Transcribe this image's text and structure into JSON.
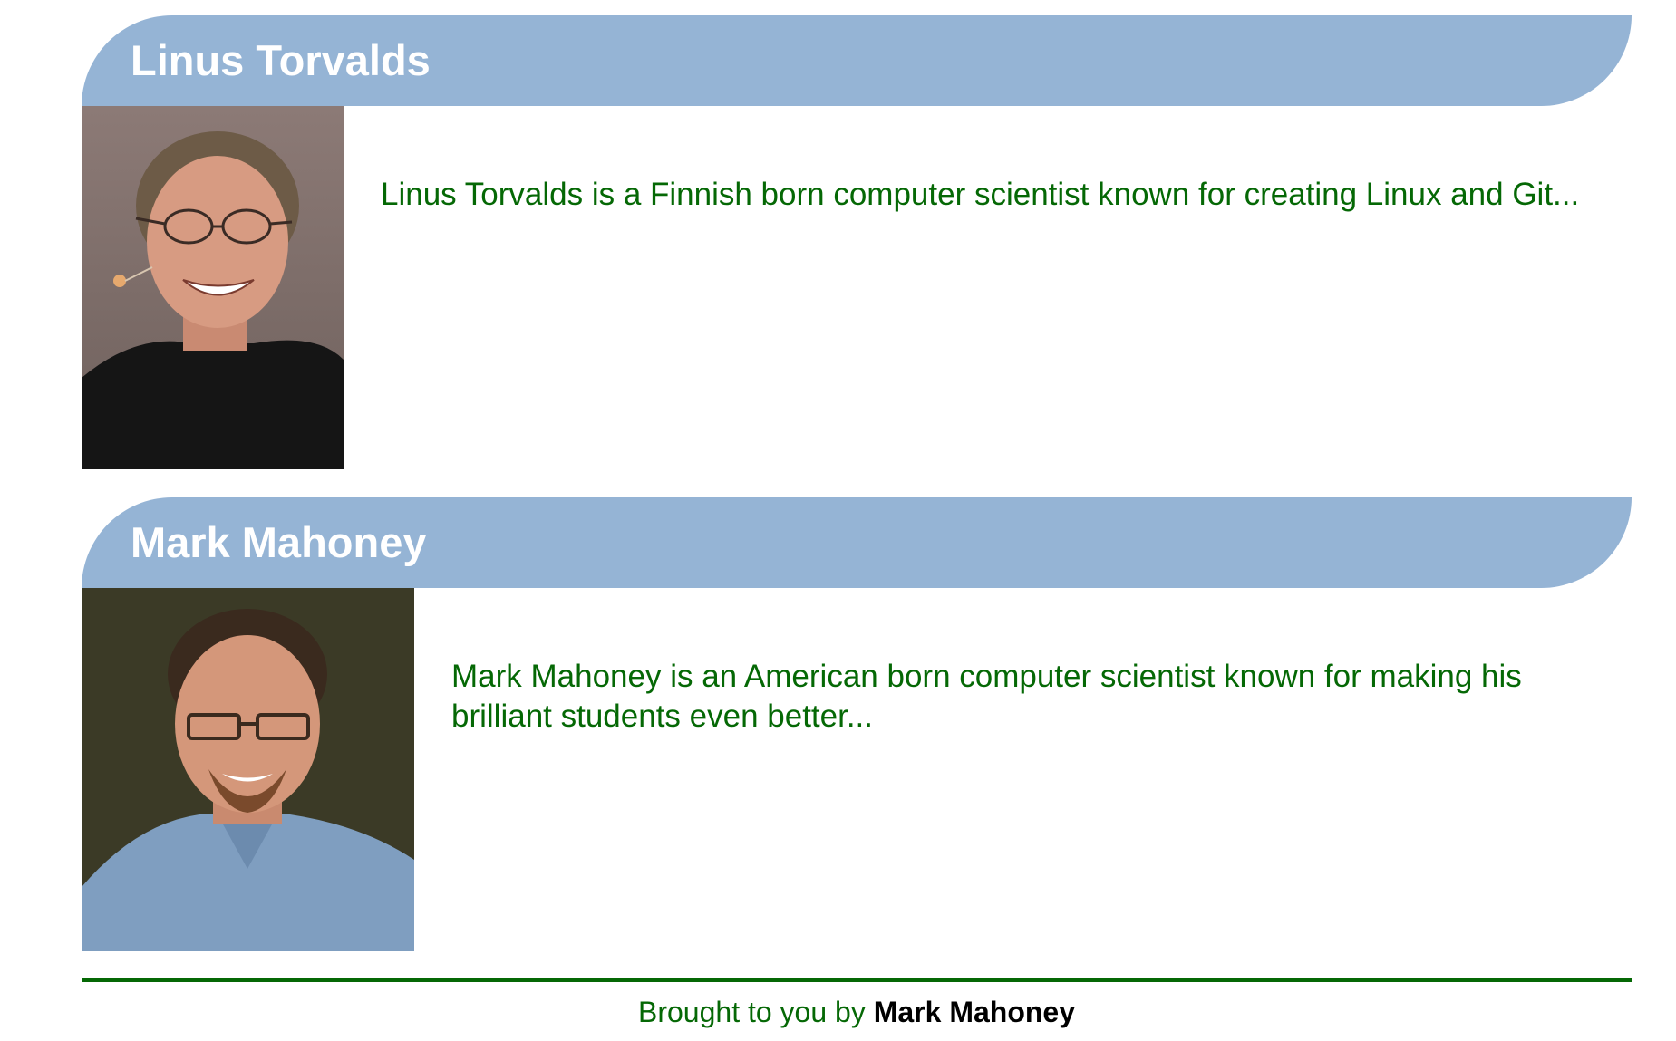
{
  "people": [
    {
      "name": "Linus Torvalds",
      "bio": "Linus Torvalds is a Finnish born computer scientist known for creating Linux and Git..."
    },
    {
      "name": "Mark Mahoney",
      "bio": "Mark Mahoney is an American born computer scientist known for making his brilliant students even better..."
    }
  ],
  "footer": {
    "prefix": "Brought to you by",
    "author": "Mark Mahoney"
  },
  "colors": {
    "header_band": "#95b4d5",
    "header_text": "#ffffff",
    "body_text": "#056805",
    "footer_rule": "#056805",
    "footer_author": "#000000"
  }
}
